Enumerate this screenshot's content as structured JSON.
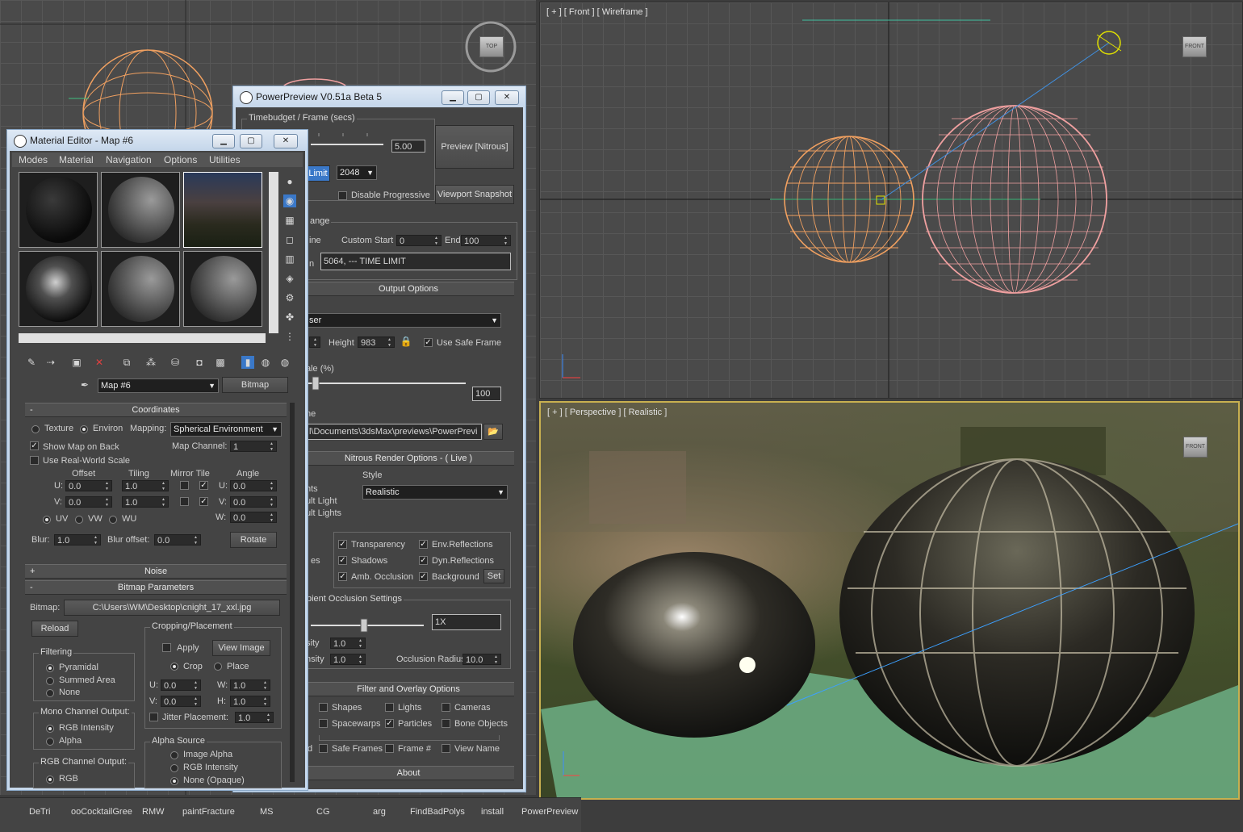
{
  "viewports": {
    "top_cube": "TOP",
    "front_label": "[ + ] [ Front ] [ Wireframe ]",
    "front_cube": "FRONT",
    "persp_label": "[ + ] [ Perspective ] [ Realistic ]",
    "persp_cube": "FRONT"
  },
  "power_preview": {
    "title": "PowerPreview V0.51a Beta 5",
    "timebudget_group": "Timebudget / Frame (secs)",
    "timebudget_value": "5.00",
    "preview_button": "Preview [Nitrous]",
    "limit_button": "Limit",
    "limit_value": "2048",
    "disable_progressive": "Disable Progressive",
    "viewport_snapshot": "Viewport Snapshot",
    "range_group": "ange",
    "range_line": "ine",
    "custom_start_label": "Custom Start",
    "custom_start_value": "0",
    "end_label": "End",
    "end_value": "100",
    "status_prefix": "n",
    "status_text": "5064,  --- TIME LIMIT",
    "output_options": "Output Options",
    "output_dd": "ser",
    "height_label": "Height",
    "height_value": "983",
    "use_safe_frame": "Use Safe Frame",
    "scale_label": "ale (%)",
    "scale_value": "100",
    "path_label": "ne",
    "path_value": "l\\Documents\\3dsMax\\previews\\PowerPrevi",
    "nitrous_options": "Nitrous Render Options - ( Live )",
    "style_label": "Style",
    "style_value": "Realistic",
    "lights_1": "hts",
    "lights_2": "ult Light",
    "lights_3": "ult Lights",
    "checks_row1": [
      "Transparency",
      "Env.Reflections"
    ],
    "checks_row2": [
      "Shadows",
      "Dyn.Reflections"
    ],
    "checks_row3": [
      "Amb. Occlusion",
      "Background"
    ],
    "res_label": "es",
    "set_button": "Set",
    "ao_group": "bient Occlusion Settings",
    "ao_value": "1X",
    "intensity_1": "sity",
    "intensity_1_value": "1.0",
    "intensity_2": "nsity",
    "intensity_2_value": "1.0",
    "occ_radius_label": "Occlusion Radius",
    "occ_radius_value": "10.0",
    "filter_overlay": "Filter and Overlay Options",
    "filter_row1": [
      "Shapes",
      "Lights",
      "Cameras"
    ],
    "filter_row2": [
      "Spacewarps",
      "Particles",
      "Bone Objects"
    ],
    "filter_row3_prefix": "d",
    "filter_row3": [
      "Safe Frames",
      "Frame #",
      "View Name"
    ],
    "about": "About"
  },
  "material_editor": {
    "title": "Material Editor - Map #6",
    "menus": [
      "Modes",
      "Material",
      "Navigation",
      "Options",
      "Utilities"
    ],
    "map_name": "Map #6",
    "map_type": "Bitmap",
    "coordinates": "Coordinates",
    "texture_label": "Texture",
    "environ_label": "Environ",
    "mapping_label": "Mapping:",
    "mapping_value": "Spherical Environment",
    "show_map_on_back": "Show Map on Back",
    "map_channel_label": "Map Channel:",
    "map_channel_value": "1",
    "use_real_world": "Use Real-World Scale",
    "col_offset": "Offset",
    "col_tiling": "Tiling",
    "col_mirror_tile": "Mirror Tile",
    "col_angle": "Angle",
    "u_label": "U:",
    "v_label": "V:",
    "w_label": "W:",
    "offset_u": "0.0",
    "offset_v": "0.0",
    "tiling_u": "1.0",
    "tiling_v": "1.0",
    "angle_u": "0.0",
    "angle_v": "0.0",
    "angle_w": "0.0",
    "uv_options": [
      "UV",
      "VW",
      "WU"
    ],
    "blur_label": "Blur:",
    "blur_value": "1.0",
    "blur_offset_label": "Blur offset:",
    "blur_offset_value": "0.0",
    "rotate_button": "Rotate",
    "noise": "Noise",
    "bitmap_params": "Bitmap Parameters",
    "bitmap_label": "Bitmap:",
    "bitmap_path": "C:\\Users\\WM\\Desktop\\cnight_17_xxl.jpg",
    "reload_button": "Reload",
    "cropping_group": "Cropping/Placement",
    "apply_label": "Apply",
    "view_image_button": "View Image",
    "crop_label": "Crop",
    "place_label": "Place",
    "crop_u": "0.0",
    "crop_v": "0.0",
    "crop_w": "1.0",
    "crop_h": "1.0",
    "h_label": "H:",
    "jitter_label": "Jitter Placement:",
    "jitter_value": "1.0",
    "filtering_group": "Filtering",
    "filtering_options": [
      "Pyramidal",
      "Summed Area",
      "None"
    ],
    "mono_group": "Mono Channel Output:",
    "mono_options": [
      "RGB Intensity",
      "Alpha"
    ],
    "rgb_group": "RGB Channel Output:",
    "rgb_options": [
      "RGB"
    ],
    "alpha_group": "Alpha Source",
    "alpha_options": [
      "Image Alpha",
      "RGB Intensity",
      "None (Opaque)"
    ]
  },
  "taskbar": {
    "items": [
      "DeTri",
      "ooCocktailGree",
      "RMW",
      "paintFracture",
      "MS",
      "CG",
      "arg",
      "FindBadPolys",
      "install",
      "PowerPreview"
    ]
  },
  "colors": {
    "viewport_bg": "#4a4a4a",
    "sphere_orange": "#f0a060",
    "sphere_pink": "#f0a0a0",
    "panel_bg": "#444444",
    "title_bar": "#d2e0f0",
    "highlight_blue": "#3a78c8"
  }
}
